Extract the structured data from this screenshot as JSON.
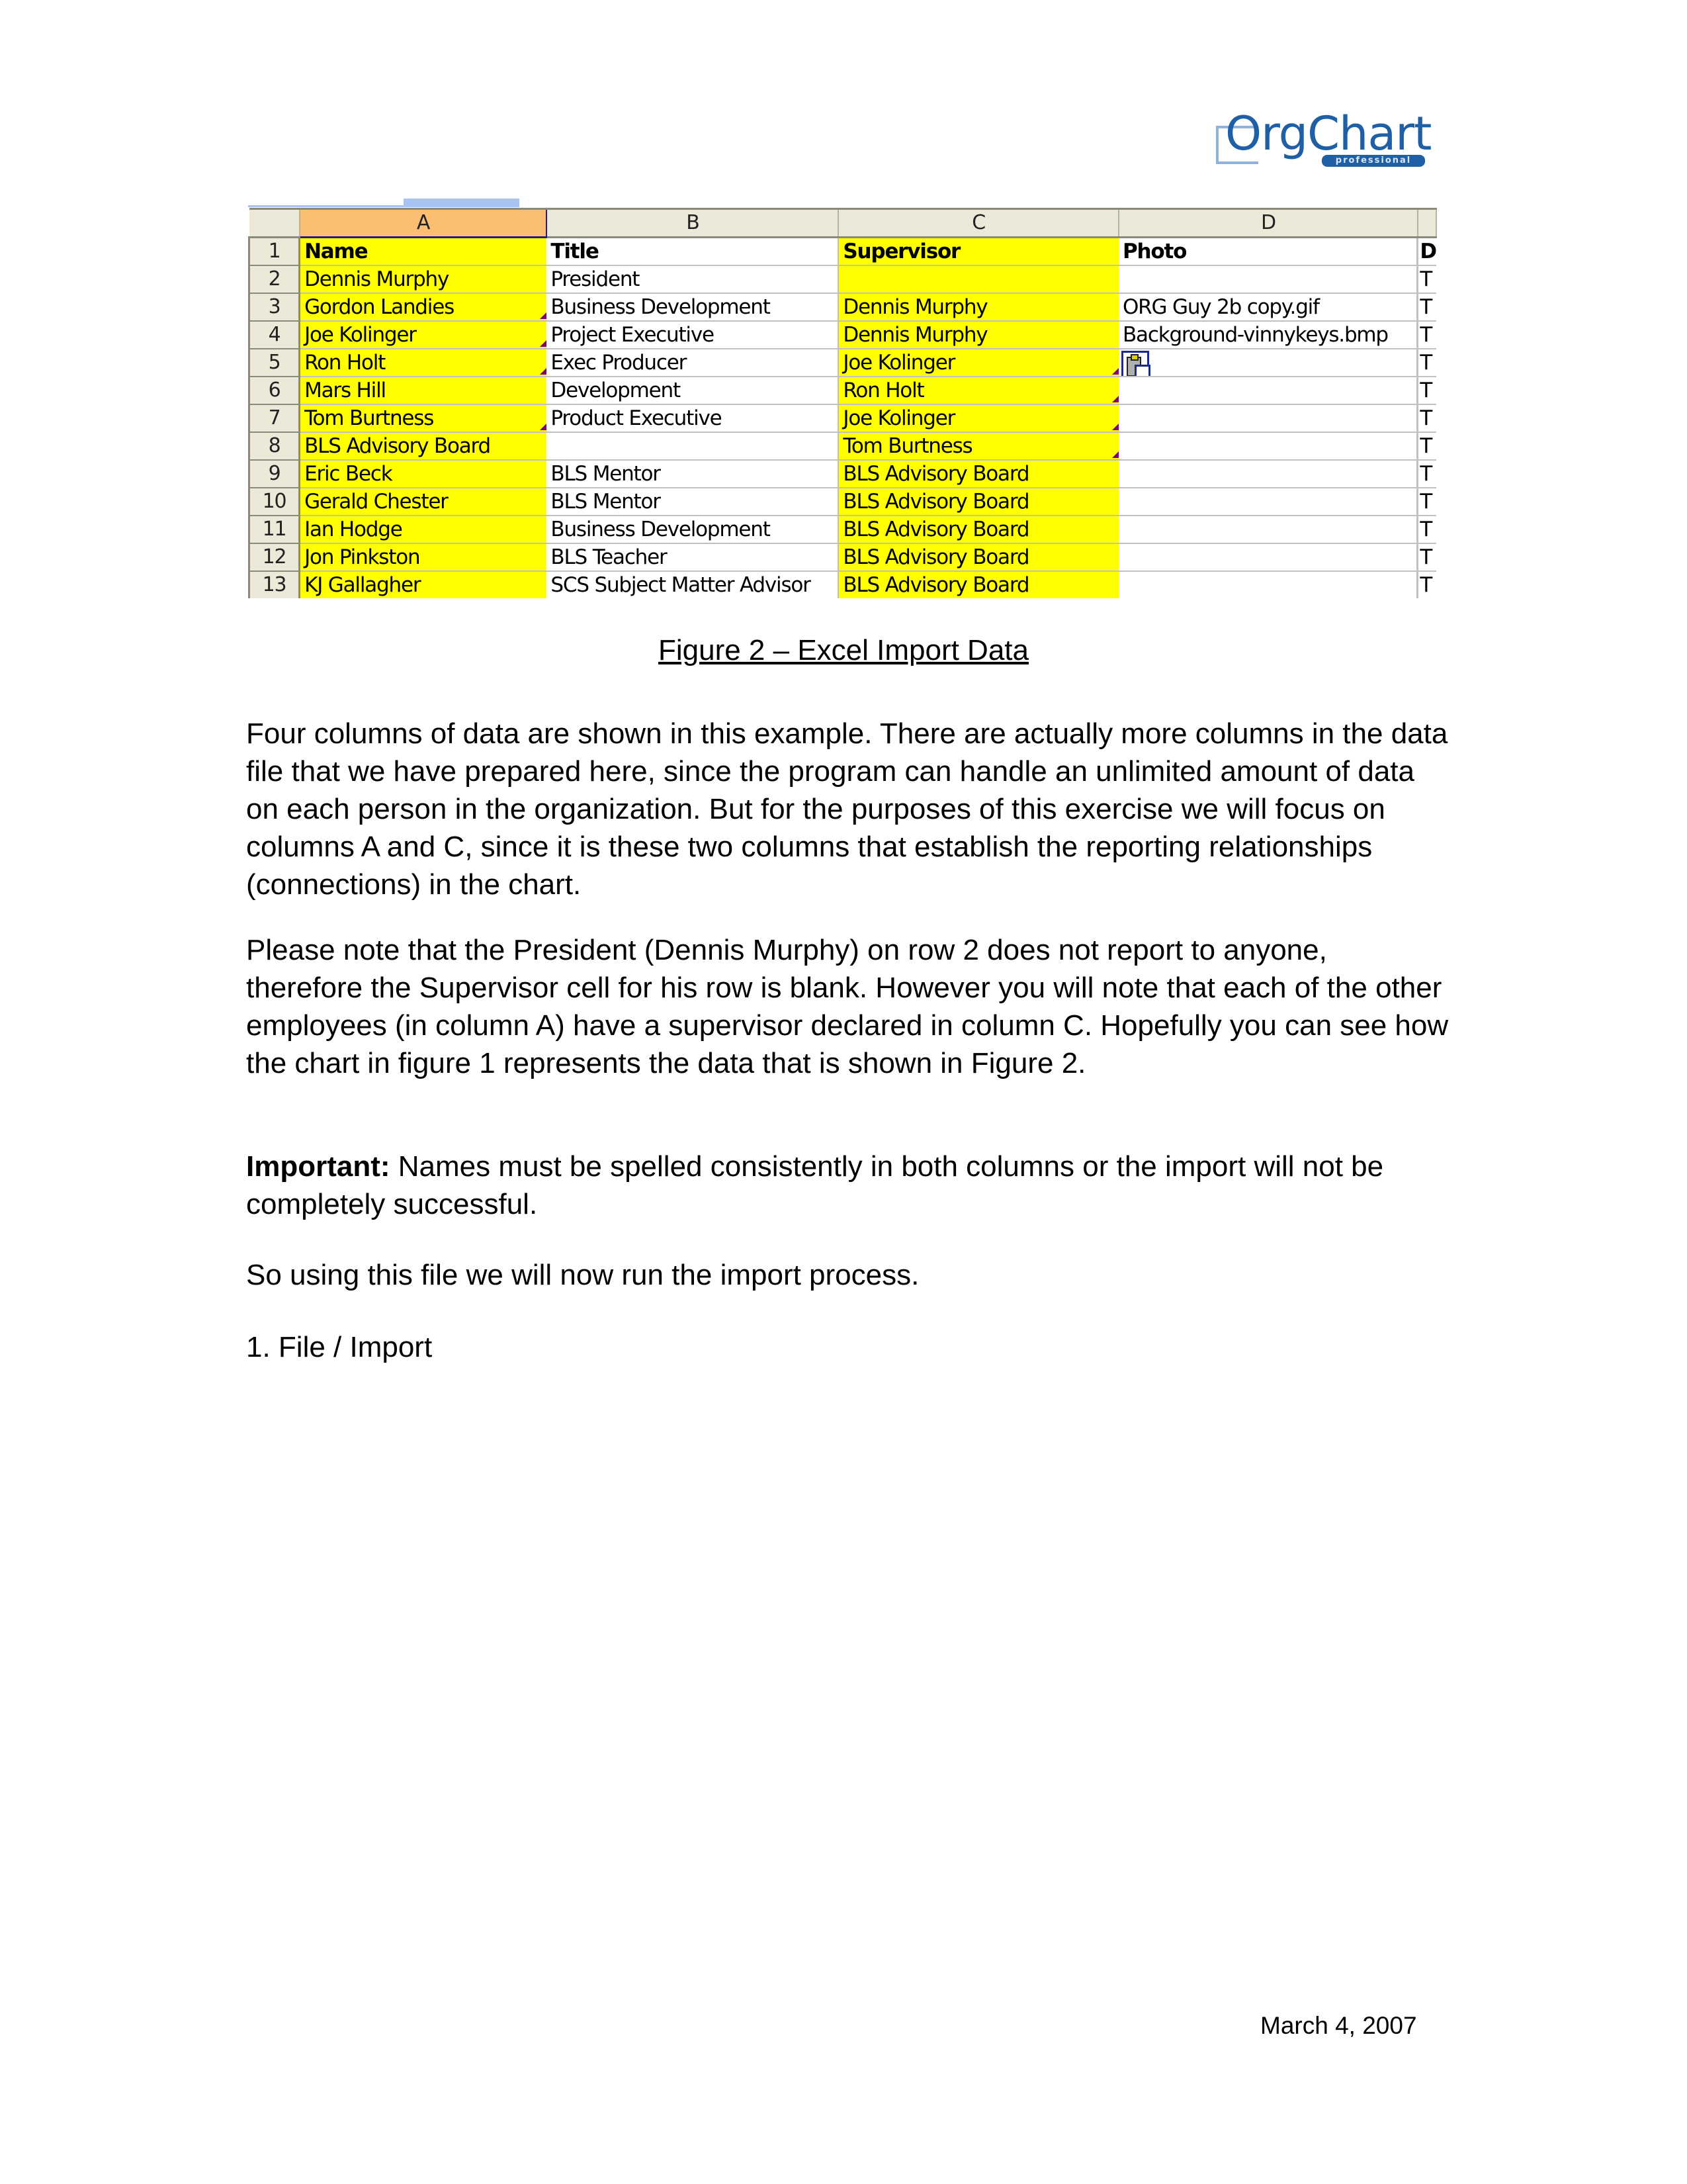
{
  "logo": {
    "word": "OrgChart",
    "sub": "professional"
  },
  "spreadsheet": {
    "column_letters": [
      "A",
      "B",
      "C",
      "D",
      ""
    ],
    "selected_column": "A",
    "rows": [
      {
        "num": "1",
        "a": "Name",
        "b": "Title",
        "c": "Supervisor",
        "d": "Photo",
        "e": "D"
      },
      {
        "num": "2",
        "a": "Dennis Murphy",
        "b": "President",
        "c": "",
        "d": "",
        "e": "T"
      },
      {
        "num": "3",
        "a": "Gordon Landies",
        "b": "Business Development",
        "c": "Dennis Murphy",
        "d": "ORG Guy 2b copy.gif",
        "e": "T"
      },
      {
        "num": "4",
        "a": "Joe Kolinger",
        "b": "Project Executive",
        "c": "Dennis Murphy",
        "d": "Background-vinnykeys.bmp",
        "e": "T"
      },
      {
        "num": "5",
        "a": "Ron Holt",
        "b": "Exec Producer",
        "c": "Joe Kolinger",
        "d": "",
        "e": "T"
      },
      {
        "num": "6",
        "a": "Mars Hill",
        "b": "Development",
        "c": "Ron Holt",
        "d": "",
        "e": "T"
      },
      {
        "num": "7",
        "a": "Tom Burtness",
        "b": "Product Executive",
        "c": "Joe Kolinger",
        "d": "",
        "e": "T"
      },
      {
        "num": "8",
        "a": "BLS Advisory Board",
        "b": "",
        "c": "Tom Burtness",
        "d": "",
        "e": "T"
      },
      {
        "num": "9",
        "a": "Eric Beck",
        "b": "BLS Mentor",
        "c": "BLS Advisory Board",
        "d": "",
        "e": "T"
      },
      {
        "num": "10",
        "a": "Gerald Chester",
        "b": "BLS Mentor",
        "c": "BLS Advisory Board",
        "d": "",
        "e": "T"
      },
      {
        "num": "11",
        "a": "Ian Hodge",
        "b": "Business Development",
        "c": "BLS Advisory Board",
        "d": "",
        "e": "T"
      },
      {
        "num": "12",
        "a": "Jon Pinkston",
        "b": "BLS Teacher",
        "c": "BLS Advisory Board",
        "d": "",
        "e": "T"
      },
      {
        "num": "13",
        "a": "KJ Gallagher",
        "b": "SCS Subject Matter Advisor",
        "c": "BLS Advisory Board",
        "d": "",
        "e": "T"
      }
    ],
    "highlight_color": "#ffff00",
    "selected_header_color": "#fbbe73",
    "comment_marker_color": "#7b007b"
  },
  "caption": "Figure 2 – Excel Import Data",
  "paragraphs": {
    "p1": "Four columns of data are shown in this example.  There are actually more columns in the data file that we have prepared here, since the program can handle an unlimited amount of data on each person in the organization.  But for the purposes of this exercise we will focus on columns A and C, since it is these two columns that establish the reporting relationships (connections) in the chart.",
    "p2": "Please note that the President (Dennis Murphy) on row 2 does not report to anyone, therefore the Supervisor cell for his row is blank. However you will note that each of the other employees (in column A) have a supervisor declared in column C.  Hopefully you can see how the chart in figure 1 represents the data that is shown in Figure 2.",
    "p3_label": "Important:",
    "p3": " Names must be spelled consistently in both columns or the import will not be completely successful.",
    "p4": "So using this file we will now run the import process.",
    "step1": "1.  File / Import"
  },
  "footer": {
    "date": "March 4, 2007"
  }
}
